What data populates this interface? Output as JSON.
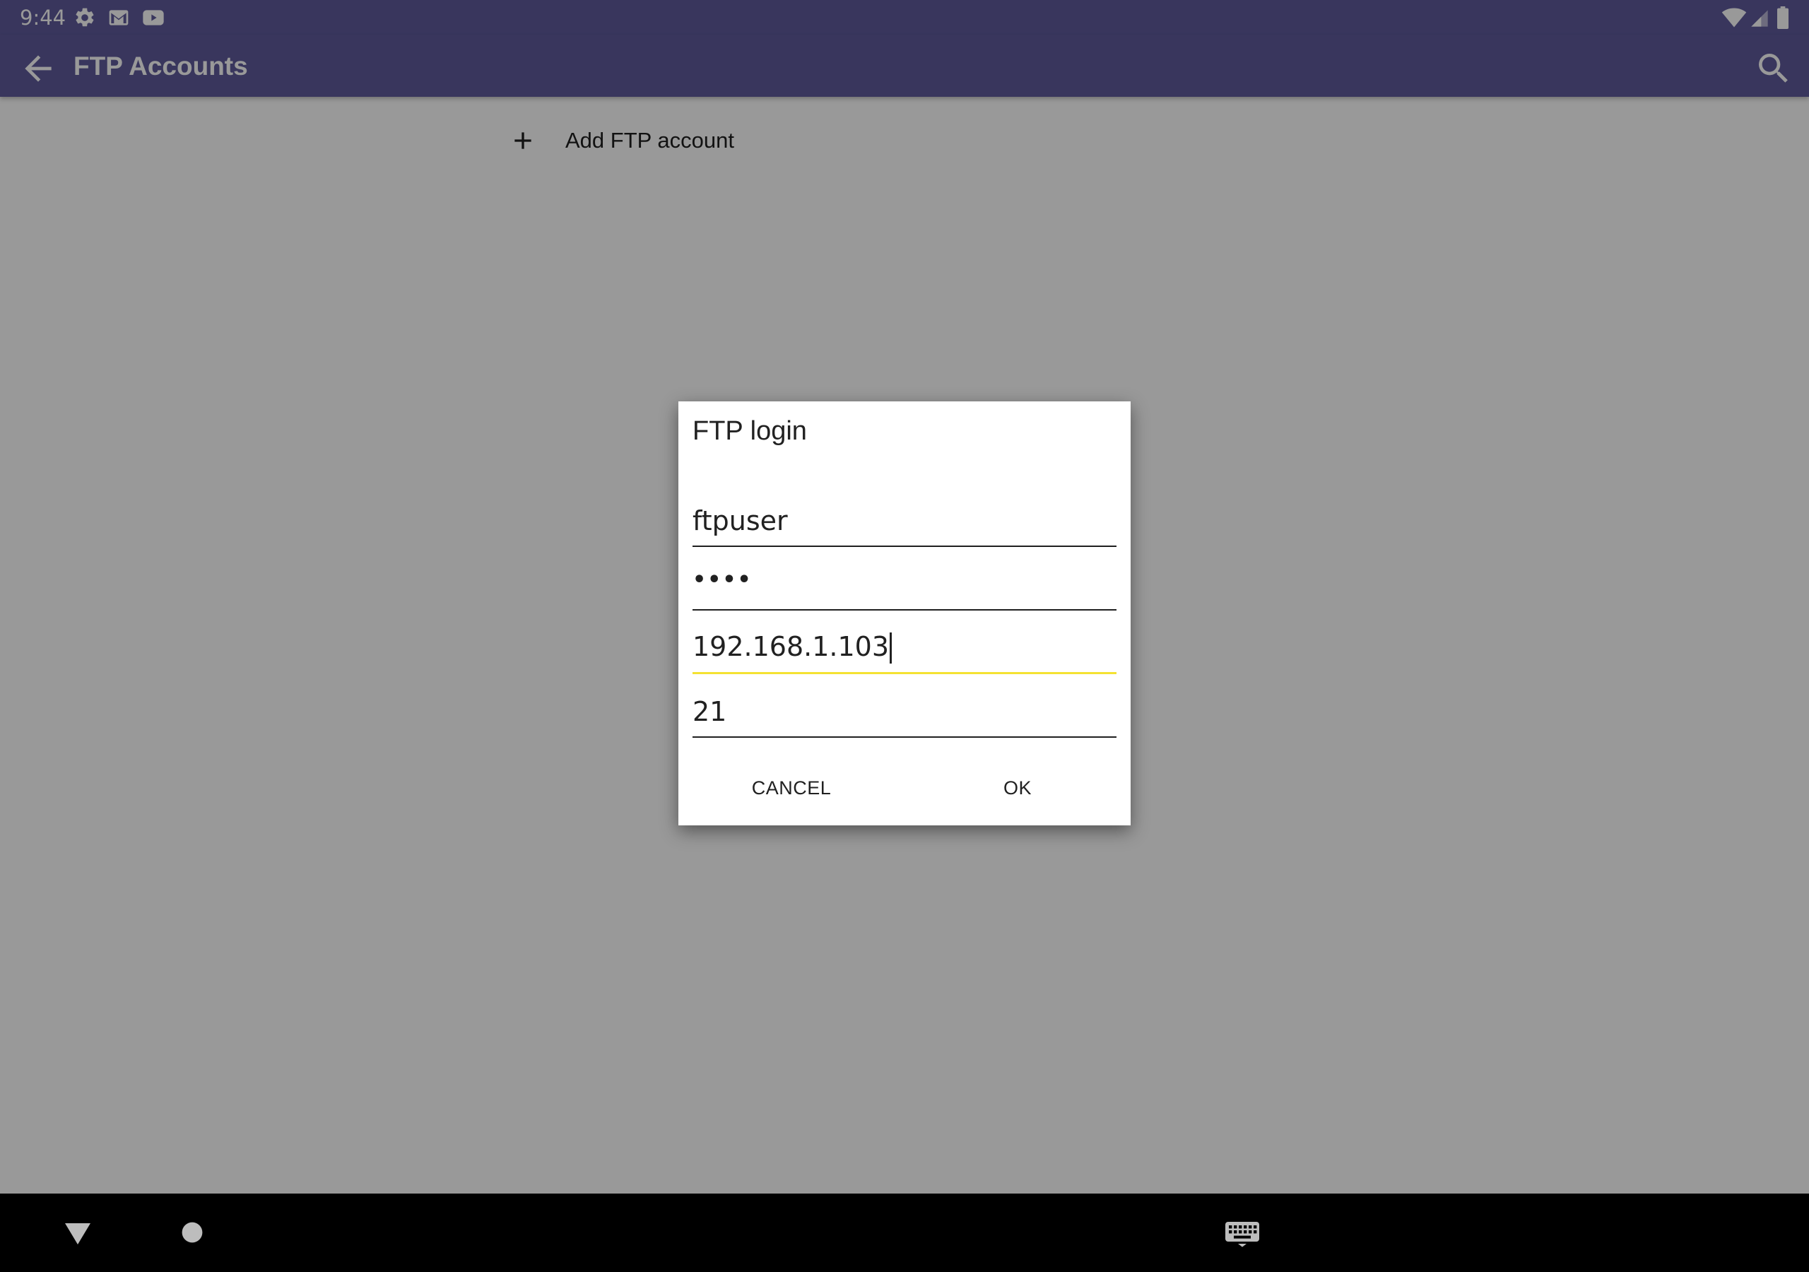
{
  "status_bar": {
    "time": "9:44",
    "left_icons": [
      "settings-icon",
      "gmail-icon",
      "youtube-icon"
    ],
    "right_icons": [
      "wifi-icon",
      "cellular-signal-icon",
      "battery-icon"
    ]
  },
  "app_bar": {
    "title": "FTP Accounts",
    "back_icon": "arrow-back-icon",
    "search_icon": "search-icon",
    "color": "#5f5b9c"
  },
  "content": {
    "add_account_label": "Add FTP account",
    "add_icon": "plus-icon"
  },
  "dialog": {
    "title": "FTP login",
    "fields": {
      "username": "ftpuser",
      "password_mask": "••••",
      "host": "192.168.1.103",
      "port": "21"
    },
    "focused_field": "host",
    "focus_color": "#f4e232",
    "cancel_label": "CANCEL",
    "ok_label": "OK"
  },
  "nav_bar": {
    "icons": [
      "back-triangle-icon",
      "home-circle-icon",
      "keyboard-icon"
    ]
  }
}
